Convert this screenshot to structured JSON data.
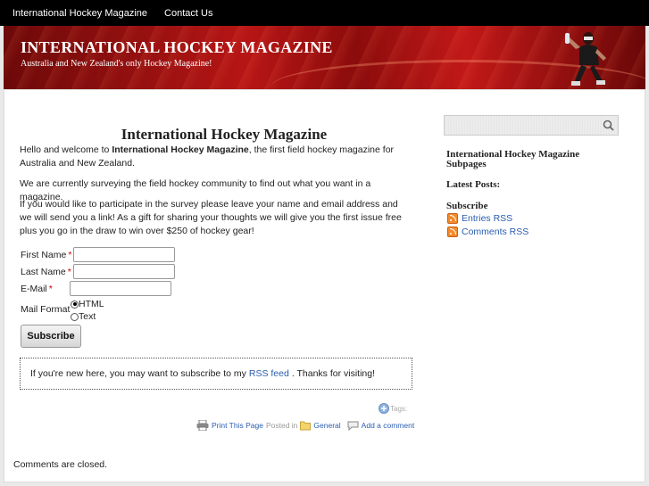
{
  "nav": {
    "items": [
      "International Hockey Magazine",
      "Contact Us"
    ]
  },
  "header": {
    "title": "INTERNATIONAL HOCKEY MAGAZINE",
    "tagline": "Australia and New Zealand's only Hockey Magazine!"
  },
  "post": {
    "title": "International Hockey Magazine",
    "intro_before": "Hello and welcome to ",
    "intro_bold": "International Hockey Magazine",
    "intro_after": ", the first field hockey magazine for Australia and New Zealand.",
    "p2": "We are currently surveying the field hockey community to find out what you want in a magazine.",
    "p3": "If you would like to participate in the survey please leave your name and email address and we will send you a link! As a gift for sharing your thoughts we will give you the first issue free plus you go in the draw to win over $250 of hockey gear!"
  },
  "form": {
    "first_name_label": "First Name",
    "last_name_label": "Last Name",
    "email_label": "E-Mail",
    "required_mark": "*",
    "mail_format_label": "Mail Format",
    "option_html": "HTML",
    "option_text": "Text",
    "selected_format": "HTML",
    "subscribe_label": "Subscribe"
  },
  "notice": {
    "before": "If you're new here, you may want to subscribe to my",
    "link": "RSS feed",
    "after": ". Thanks for visiting!"
  },
  "postmeta": {
    "tags_label": "Tags:",
    "print_label": "Print This Page",
    "posted_in": "Posted in",
    "category": "General",
    "comment_link": "Add a comment"
  },
  "comments_closed": "Comments are closed.",
  "sidebar": {
    "subpages_heading": "International Hockey Magazine Subpages",
    "latest_heading": "Latest Posts:",
    "subscribe_heading": "Subscribe",
    "entries_rss": "Entries RSS",
    "comments_rss": "Comments RSS"
  },
  "colors": {
    "header_red": "#a81212",
    "link_blue": "#2a5db0",
    "nav_bg": "#000000",
    "rss_orange": "#f48a2a"
  }
}
